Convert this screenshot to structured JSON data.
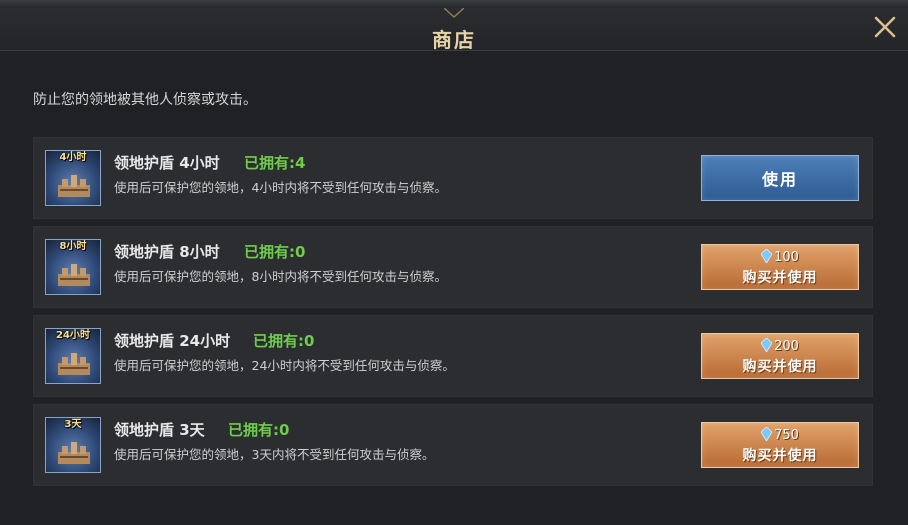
{
  "header": {
    "title": "商店"
  },
  "subtitle": "防止您的领地被其他人侦察或攻击。",
  "items": [
    {
      "badge": "4小时",
      "name": "领地护盾 4小时",
      "owned": "已拥有:4",
      "desc": "使用后可保护您的领地，4小时内将不受到任何攻击与侦察。",
      "action": "使用"
    },
    {
      "badge": "8小时",
      "name": "领地护盾 8小时",
      "owned": "已拥有:0",
      "desc": "使用后可保护您的领地，8小时内将不受到任何攻击与侦察。",
      "price": "100",
      "action": "购买并使用"
    },
    {
      "badge": "24小时",
      "name": "领地护盾 24小时",
      "owned": "已拥有:0",
      "desc": "使用后可保护您的领地，24小时内将不受到任何攻击与侦察。",
      "price": "200",
      "action": "购买并使用"
    },
    {
      "badge": "3天",
      "name": "领地护盾 3天",
      "owned": "已拥有:0",
      "desc": "使用后可保护您的领地，3天内将不受到任何攻击与侦察。",
      "price": "750",
      "action": "购买并使用"
    }
  ],
  "colors": {
    "owned_green": "#6fcd4a",
    "use_button_blue": "#3d6ca6",
    "buy_button_orange": "#c97d43",
    "title_gold": "#e6d3a8"
  },
  "icons": {
    "close": "close-icon",
    "gem": "gem-icon",
    "shield": "shield-fortress-icon"
  }
}
